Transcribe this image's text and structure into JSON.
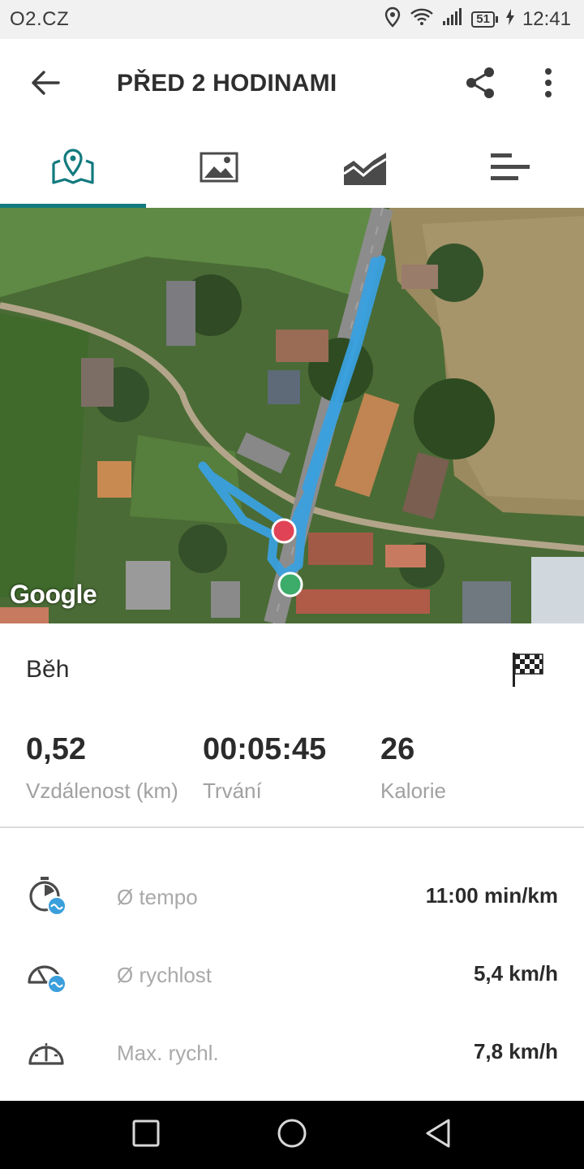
{
  "status_bar": {
    "carrier": "O2.CZ",
    "battery": "51",
    "time": "12:41"
  },
  "app_bar": {
    "title": "PŘED 2 HODINAMI",
    "icons": [
      "back-arrow-icon",
      "share-icon",
      "more-vertical-icon"
    ]
  },
  "tabs": [
    {
      "icon": "map-pin-icon",
      "active": true
    },
    {
      "icon": "image-icon",
      "active": false
    },
    {
      "icon": "chart-area-icon",
      "active": false
    },
    {
      "icon": "list-bars-icon",
      "active": false
    }
  ],
  "map": {
    "attribution": "Google",
    "route_color": "#3aa0de",
    "start_marker_color": "#3dab6a",
    "end_marker_color": "#e04355"
  },
  "activity": {
    "name": "Běh",
    "icon": "checkered-flag-icon"
  },
  "summary": {
    "distance_value": "0,52",
    "distance_label": "Vzdálenost (km)",
    "duration_value": "00:05:45",
    "duration_label": "Trvání",
    "calories_value": "26",
    "calories_label": "Kalorie"
  },
  "details": [
    {
      "icon": "stopwatch-avg-icon",
      "label": "Ø tempo",
      "value": "11:00 min/km"
    },
    {
      "icon": "speedometer-avg-icon",
      "label": "Ø rychlost",
      "value": "5,4 km/h"
    },
    {
      "icon": "speedometer-icon",
      "label": "Max. rychl.",
      "value": "7,8 km/h"
    }
  ],
  "colors": {
    "accent": "#127a7e",
    "label_gray": "#a1a1a1",
    "text_dark": "#2b2b2b"
  }
}
